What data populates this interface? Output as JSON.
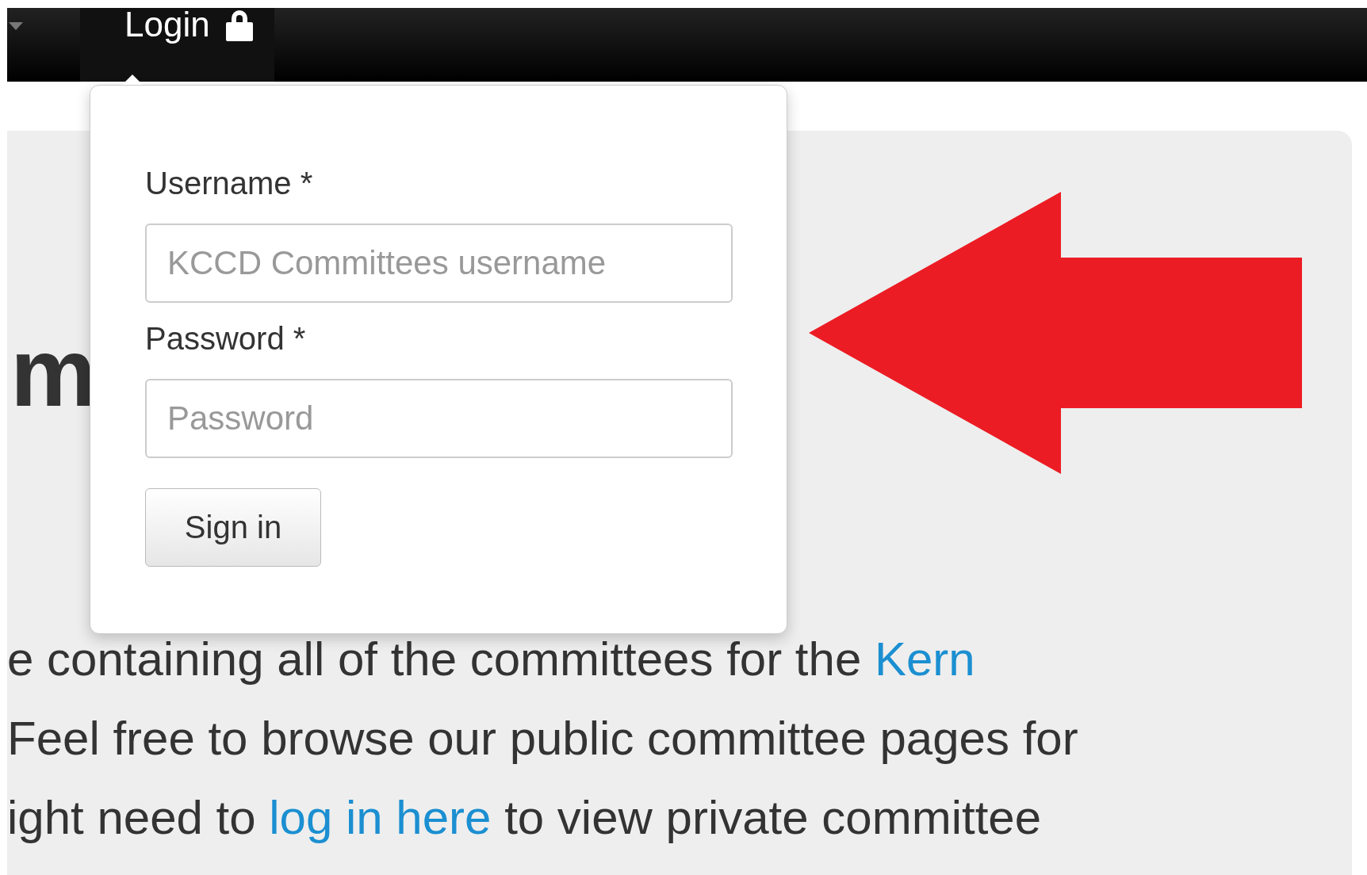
{
  "navbar": {
    "login": {
      "label": "Login",
      "expanded": true
    }
  },
  "login_form": {
    "fields": [
      {
        "label": "Username *",
        "placeholder": "KCCD Committees username"
      },
      {
        "label": "Password *",
        "placeholder": "Password"
      }
    ],
    "button": "Sign in"
  },
  "jumbotron": {
    "heading": "m",
    "lines": [
      {
        "parts": [
          {
            "text": "e containing all of the committees for the ",
            "link": false
          },
          {
            "text": "Kern",
            "link": true
          }
        ]
      },
      {
        "parts": [
          {
            "text": "Feel free to browse our public committee pages for",
            "link": false
          }
        ]
      },
      {
        "parts": [
          {
            "text": "ight need to ",
            "link": false
          },
          {
            "text": "log in here",
            "link": true
          },
          {
            "text": " to view private committee",
            "link": false
          }
        ]
      }
    ]
  }
}
